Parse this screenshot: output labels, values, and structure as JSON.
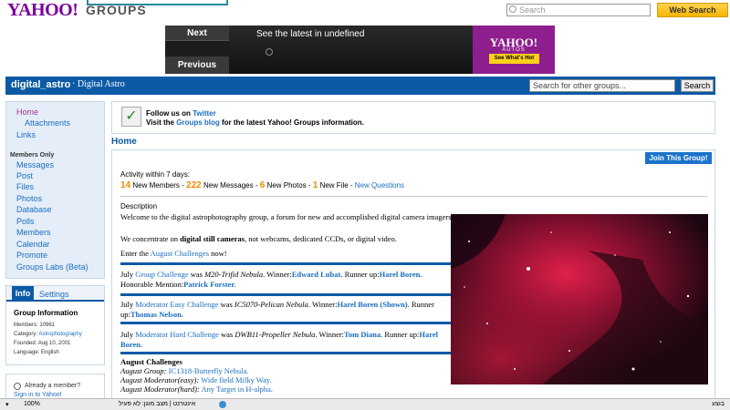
{
  "header": {
    "logo_text": "YAHOO!",
    "logo_groups": "GROUPS",
    "search_placeholder": "Search",
    "web_search_label": "Web Search"
  },
  "ad": {
    "next_label": "Next",
    "prev_label": "Previous",
    "headline": "See the latest in undefined",
    "autos_logo": "YAHOO!",
    "autos_sub": "AUTOS",
    "autos_button": "See What's Hot"
  },
  "group_bar": {
    "name": "digital_astro",
    "subtitle": "· Digital Astro",
    "search_placeholder": "Search for other groups...",
    "search_button": "Search"
  },
  "nav": {
    "home": "Home",
    "attachments": "Attachments",
    "links": "Links",
    "members_only": "Members Only",
    "items": [
      "Messages",
      "Post",
      "Files",
      "Photos",
      "Database",
      "Polls",
      "Members",
      "Calendar",
      "Promote",
      "Groups Labs (Beta)"
    ]
  },
  "info": {
    "tab_info": "Info",
    "tab_settings": "Settings",
    "title": "Group Information",
    "members": "Members: 10961",
    "category_label": "Category:",
    "category_value": "Astrophotography",
    "founded": "Founded: Aug 10, 2001",
    "language": "Language: English"
  },
  "member_box": {
    "question": "Already a member?",
    "signin": "Sign in to Yahoo!"
  },
  "twitter": {
    "l1_prefix": "Follow us on ",
    "l1_link": "Twitter",
    "l2_prefix": "Visit the ",
    "l2_link": "Groups blog",
    "l2_suffix": " for the latest Yahoo! Groups information."
  },
  "main": {
    "heading": "Home",
    "join": "Join This Group!",
    "activity_label": "Activity within 7 days:",
    "activity": {
      "members_num": "14",
      "members_text": " New Members - ",
      "messages_num": "222",
      "messages_text": " New Messages - ",
      "photos_num": "6",
      "photos_text": " New Photos - ",
      "file_num": "1",
      "file_text": " New File - ",
      "questions_link": "New Questions"
    },
    "description_label": "Description",
    "welcome": "Welcome to the digital astrophotography group, a forum for new and accomplished digital camera imagers.",
    "concentrate_prefix": "We concentrate on ",
    "concentrate_bold": "digital still cameras",
    "concentrate_suffix": ", not webcams, dedicated CCDs, or digital video.",
    "enter_prefix": "Enter the ",
    "enter_link": "August Challenges",
    "enter_suffix": " now!",
    "july1": {
      "p1": "July ",
      "link": "Group Challenge",
      "p2": " was ",
      "object": "M20-Trifid Nebula",
      "p3": ". Winner:",
      "winner": "Edward Lubat",
      "p4": ". Runner up:",
      "runner": "Harel Boren.",
      "p5": " Honorable Mention:",
      "hm": "Patrick Forster."
    },
    "july2": {
      "p1": "July ",
      "link": "Moderator Easy Challenge",
      "p2": " was ",
      "object": "IC5070-Pelican Nebula",
      "p3": ". Winner:",
      "winner": "Harel Boren (Shown).",
      "p4": " Runner up:",
      "runner": "Thomas Nelson."
    },
    "july3": {
      "p1": "July ",
      "link": "Moderator Hard Challenge",
      "p2": " was ",
      "object": "DWB11-Propeller Nebula",
      "p3": ". Winner:",
      "winner": "Tom Diana",
      "p4": ". Runner up:",
      "runner": "Harel Boren."
    },
    "aug": {
      "title": "August Challenges",
      "l1_label": "August Group:",
      "l1_value": "IC1318-Butterfly Nebula.",
      "l2_label": "August Moderator(easy):",
      "l2_value": "Wide field Milky Way.",
      "l3_label": "August Moderator(hard):",
      "l3_value": "Any Target in H-alpha."
    }
  },
  "statusbar": {
    "zoom": "100%",
    "status": "אינטרנט | מצב מוגן: לא פעיל",
    "done": "בוצע"
  },
  "colors": {
    "brand": "#7b0099",
    "group_bar": "#0c5aa6",
    "link": "#1a6ec0",
    "accent_number": "#f08c00"
  }
}
